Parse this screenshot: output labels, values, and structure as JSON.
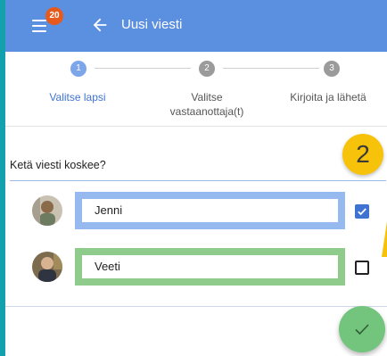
{
  "header": {
    "title": "Uusi viesti",
    "notification_count": "20",
    "menu_icon": "hamburger-menu-icon",
    "back_icon": "arrow-left-icon",
    "background_color": "#5b8fe0"
  },
  "stepper": {
    "active_color": "#3f73d1",
    "steps": [
      {
        "number": "1",
        "label": "Valitse lapsi",
        "state": "active"
      },
      {
        "number": "2",
        "label": "Valitse vastaanottaja(t)",
        "state": "inactive"
      },
      {
        "number": "3",
        "label": "Kirjoita ja lähetä",
        "state": "inactive"
      }
    ]
  },
  "form": {
    "question": "Ketä viesti koskee?",
    "selected_count": "2",
    "children": [
      {
        "name": "Jenni",
        "checked": true,
        "accent_color": "#96b9ef"
      },
      {
        "name": "Veeti",
        "checked": false,
        "accent_color": "#8fcb8a"
      }
    ]
  },
  "actions": {
    "confirm_icon": "checkmark-icon",
    "confirm_color": "#73c47c"
  }
}
